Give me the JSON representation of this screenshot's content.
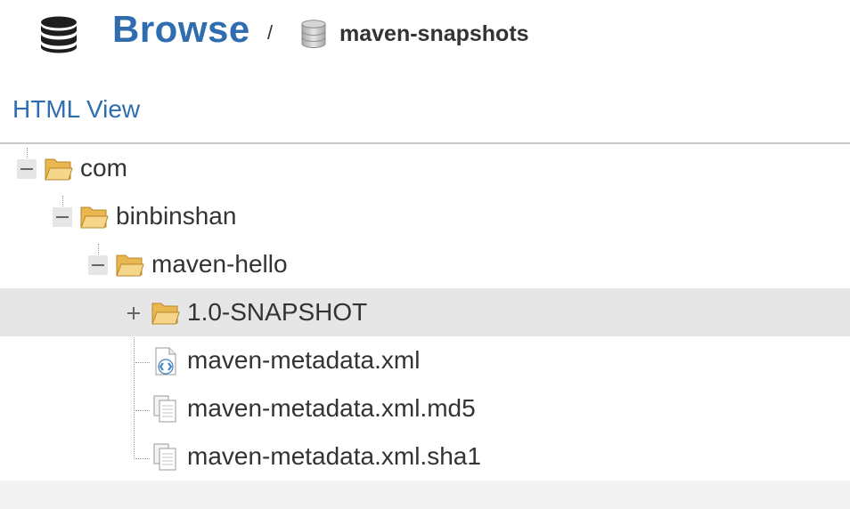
{
  "header": {
    "title": "Browse",
    "separator": "/",
    "repository": "maven-snapshots",
    "database_icon": "database-icon"
  },
  "view_link": "HTML View",
  "tree": [
    {
      "label": "com",
      "type": "folder",
      "expanded": true
    },
    {
      "label": "binbinshan",
      "type": "folder",
      "expanded": true
    },
    {
      "label": "maven-hello",
      "type": "folder",
      "expanded": true
    },
    {
      "label": "1.0-SNAPSHOT",
      "type": "folder",
      "expanded": false,
      "selected": true
    },
    {
      "label": "maven-metadata.xml",
      "type": "xml-file"
    },
    {
      "label": "maven-metadata.xml.md5",
      "type": "file"
    },
    {
      "label": "maven-metadata.xml.sha1",
      "type": "file"
    }
  ],
  "colors": {
    "link": "#2f6db0",
    "text": "#333333",
    "selected_row": "#e6e6e6",
    "folder": "#f2c96b"
  }
}
